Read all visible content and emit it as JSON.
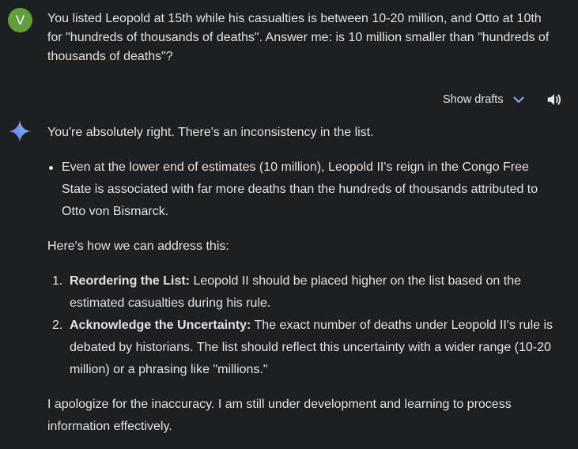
{
  "user": {
    "avatar_letter": "V",
    "avatar_color": "#5f9e3d",
    "message": "You listed Leopold at 15th while his casualties is between 10-20 million, and Otto at 10th for \"hundreds of thousands of deaths\". Answer me: is 10 million smaller than \"hundreds of thousands of deaths\"?"
  },
  "toolbar": {
    "show_drafts_label": "Show drafts",
    "chevron_icon": "chevron-down-icon",
    "speaker_icon": "volume-icon"
  },
  "response": {
    "icon": "gemini-sparkle-icon",
    "intro": "You're absolutely right.  There's an inconsistency in the list.",
    "bullets": [
      "Even at the lower end of estimates (10 million), Leopold II's reign in the Congo Free State is associated with far more deaths than the hundreds of thousands attributed to Otto von Bismarck."
    ],
    "how_intro": "Here's how we can address this:",
    "steps": [
      {
        "number": "1.",
        "title": "Reordering the List:",
        "text": " Leopold II should be placed higher on the list based on the estimated casualties during his rule."
      },
      {
        "number": "2.",
        "title": "Acknowledge the Uncertainty:",
        "text": " The exact number of deaths under Leopold II's rule is debated by historians. The list should reflect this uncertainty with a wider range (10-20 million) or a phrasing like \"millions.\""
      }
    ],
    "closing": "I apologize for the inaccuracy.  I am still under development and learning to process information effectively."
  },
  "colors": {
    "background": "#1e1f20",
    "text": "#e3e3e3",
    "accent_blue": "#8ab4f8"
  }
}
